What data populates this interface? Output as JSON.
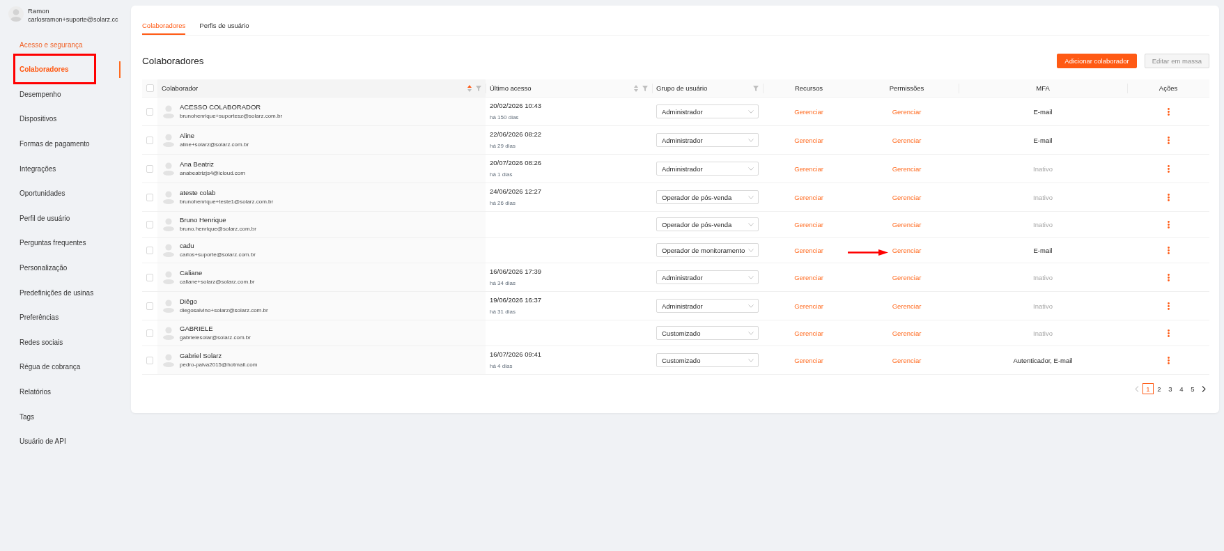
{
  "sidebar": {
    "user": {
      "name": "Ramon",
      "email": "carlosramon+suporte@solarz.cc"
    },
    "section_title": "Acesso e segurança",
    "items": [
      {
        "label": "Colaboradores",
        "selected": true,
        "annotation_box": true
      },
      {
        "label": "Desempenho",
        "selected": false,
        "annotation_box": false
      },
      {
        "label": "Dispositivos",
        "selected": false,
        "annotation_box": false
      },
      {
        "label": "Formas de pagamento",
        "selected": false,
        "annotation_box": false
      },
      {
        "label": "Integrações",
        "selected": false,
        "annotation_box": false
      },
      {
        "label": "Oportunidades",
        "selected": false,
        "annotation_box": false
      },
      {
        "label": "Perfil de usuário",
        "selected": false,
        "annotation_box": false
      },
      {
        "label": "Perguntas frequentes",
        "selected": false,
        "annotation_box": false
      },
      {
        "label": "Personalização",
        "selected": false,
        "annotation_box": false
      },
      {
        "label": "Predefinições de usinas",
        "selected": false,
        "annotation_box": false
      },
      {
        "label": "Preferências",
        "selected": false,
        "annotation_box": false
      },
      {
        "label": "Redes sociais",
        "selected": false,
        "annotation_box": false
      },
      {
        "label": "Régua de cobrança",
        "selected": false,
        "annotation_box": false
      },
      {
        "label": "Relatórios",
        "selected": false,
        "annotation_box": false
      },
      {
        "label": "Tags",
        "selected": false,
        "annotation_box": false
      },
      {
        "label": "Usuário de API",
        "selected": false,
        "annotation_box": false
      }
    ]
  },
  "tabs": [
    {
      "label": "Colaboradores",
      "selected": true
    },
    {
      "label": "Perfis de usuário",
      "selected": false
    }
  ],
  "page_title": "Colaboradores",
  "buttons": [
    {
      "label": "Adicionar colaborador",
      "kind": "primary",
      "disabled": false
    },
    {
      "label": "Editar em massa",
      "kind": "secondary",
      "disabled": true
    }
  ],
  "table": {
    "select_all": {
      "checked": false
    },
    "columns": [
      {
        "label": "Colaborador",
        "sortable": true,
        "sorted": true,
        "filter": true
      },
      {
        "label": "Último acesso",
        "sortable": true,
        "sorted": false,
        "filter": true
      },
      {
        "label": "Grupo de usuário",
        "sortable": false,
        "filter": true
      },
      {
        "label": "Recursos",
        "sortable": false,
        "filter": false
      },
      {
        "label": "Permissões",
        "sortable": false,
        "filter": false
      },
      {
        "label": "MFA",
        "sortable": false,
        "filter": false
      },
      {
        "label": "Ações",
        "sortable": false,
        "filter": false
      }
    ],
    "rows": [
      {
        "checked": false,
        "name": "ACESSO COLABORADOR",
        "email": "brunohenrique+suportesz@solarz.com.br",
        "last_access": {
          "date": "20/02/2026 10:43",
          "ago": "há 150 dias"
        },
        "group": "Administrador",
        "resources": "Gerenciar",
        "permissions": {
          "label": "Gerenciar",
          "annotation_arrow": false
        },
        "mfa": {
          "text": "E-mail",
          "enabled": true
        }
      },
      {
        "checked": false,
        "name": "Aline",
        "email": "aline+solarz@solarz.com.br",
        "last_access": {
          "date": "22/06/2026 08:22",
          "ago": "há 29 dias"
        },
        "group": "Administrador",
        "resources": "Gerenciar",
        "permissions": {
          "label": "Gerenciar",
          "annotation_arrow": false
        },
        "mfa": {
          "text": "E-mail",
          "enabled": true
        }
      },
      {
        "checked": false,
        "name": "Ana Beatriz",
        "email": "anabeatrizjs4@icloud.com",
        "last_access": {
          "date": "20/07/2026 08:26",
          "ago": "há 1 dias"
        },
        "group": "Administrador",
        "resources": "Gerenciar",
        "permissions": {
          "label": "Gerenciar",
          "annotation_arrow": false
        },
        "mfa": {
          "text": "Inativo",
          "enabled": false
        }
      },
      {
        "checked": false,
        "name": "ateste colab",
        "email": "brunohenrique+teste1@solarz.com.br",
        "last_access": {
          "date": "24/06/2026 12:27",
          "ago": "há 26 dias"
        },
        "group": "Operador de pós-venda",
        "resources": "Gerenciar",
        "permissions": {
          "label": "Gerenciar",
          "annotation_arrow": false
        },
        "mfa": {
          "text": "Inativo",
          "enabled": false
        }
      },
      {
        "checked": false,
        "name": "Bruno Henrique",
        "email": "bruno.henrique@solarz.com.br",
        "group": "Operador de pós-venda",
        "resources": "Gerenciar",
        "permissions": {
          "label": "Gerenciar",
          "annotation_arrow": false
        },
        "mfa": {
          "text": "Inativo",
          "enabled": false
        }
      },
      {
        "checked": false,
        "name": "cadu",
        "email": "carlos+suporte@solarz.com.br",
        "group": "Operador de monitoramento",
        "resources": "Gerenciar",
        "permissions": {
          "label": "Gerenciar",
          "annotation_arrow": true
        },
        "mfa": {
          "text": "E-mail",
          "enabled": true
        }
      },
      {
        "checked": false,
        "name": "Caliane",
        "email": "caliane+solarz@solarz.com.br",
        "last_access": {
          "date": "16/06/2026 17:39",
          "ago": "há 34 dias"
        },
        "group": "Administrador",
        "resources": "Gerenciar",
        "permissions": {
          "label": "Gerenciar",
          "annotation_arrow": false
        },
        "mfa": {
          "text": "Inativo",
          "enabled": false
        }
      },
      {
        "checked": false,
        "name": "Diêgo",
        "email": "diegosalvino+solarz@solarz.com.br",
        "last_access": {
          "date": "19/06/2026 16:37",
          "ago": "há 31 dias"
        },
        "group": "Administrador",
        "resources": "Gerenciar",
        "permissions": {
          "label": "Gerenciar",
          "annotation_arrow": false
        },
        "mfa": {
          "text": "Inativo",
          "enabled": false
        }
      },
      {
        "checked": false,
        "name": "GABRIELE",
        "email": "gabrielesolar@solarz.com.br",
        "group": "Customizado",
        "resources": "Gerenciar",
        "permissions": {
          "label": "Gerenciar",
          "annotation_arrow": false
        },
        "mfa": {
          "text": "Inativo",
          "enabled": false
        }
      },
      {
        "checked": false,
        "name": "Gabriel Solarz",
        "email": "pedro-paiva2015@hotmail.com",
        "last_access": {
          "date": "16/07/2026 09:41",
          "ago": "há 4 dias"
        },
        "group": "Customizado",
        "resources": "Gerenciar",
        "permissions": {
          "label": "Gerenciar",
          "annotation_arrow": false
        },
        "mfa": {
          "text": "Autenticador, E-mail",
          "enabled": true
        }
      }
    ]
  },
  "pagination": {
    "prev": {
      "disabled": true
    },
    "pages": [
      {
        "label": "1",
        "selected": true
      },
      {
        "label": "2",
        "selected": false
      },
      {
        "label": "3",
        "selected": false
      },
      {
        "label": "4",
        "selected": false
      },
      {
        "label": "5",
        "selected": false
      }
    ],
    "next": {
      "disabled": false
    }
  }
}
